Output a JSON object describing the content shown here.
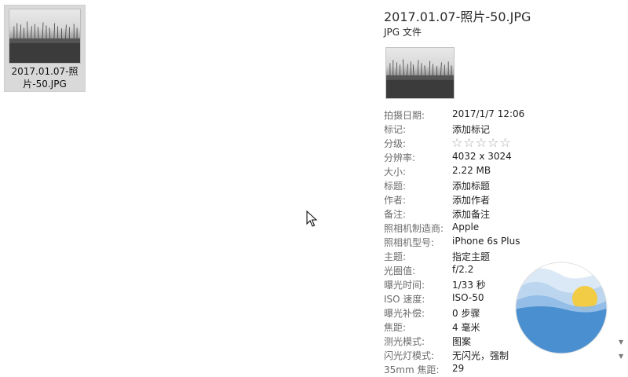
{
  "file_tile": {
    "name": "2017.01.07-照片-50.JPG"
  },
  "details": {
    "file_name": "2017.01.07-照片-50.JPG",
    "file_type": "JPG 文件",
    "properties": [
      {
        "label": "拍摄日期:",
        "value": "2017/1/7 12:06"
      },
      {
        "label": "标记:",
        "value": "添加标记"
      },
      {
        "label": "分级:",
        "value": "☆☆☆☆☆",
        "rating": 0,
        "rating_max": 5
      },
      {
        "label": "分辨率:",
        "value": "4032 x 3024"
      },
      {
        "label": "大小:",
        "value": "2.22 MB"
      },
      {
        "label": "标题:",
        "value": "添加标题"
      },
      {
        "label": "作者:",
        "value": "添加作者"
      },
      {
        "label": "备注:",
        "value": "添加备注"
      },
      {
        "label": "照相机制造商:",
        "value": "Apple"
      },
      {
        "label": "照相机型号:",
        "value": "iPhone 6s Plus"
      },
      {
        "label": "主题:",
        "value": "指定主题"
      },
      {
        "label": "光圈值:",
        "value": "f/2.2"
      },
      {
        "label": "曝光时间:",
        "value": "1/33 秒"
      },
      {
        "label": "ISO 速度:",
        "value": "ISO-50"
      },
      {
        "label": "曝光补偿:",
        "value": "0 步骤"
      },
      {
        "label": "焦距:",
        "value": "4 毫米"
      },
      {
        "label": "测光模式:",
        "value": "图案"
      },
      {
        "label": "闪光灯模式:",
        "value": "无闪光，强制"
      },
      {
        "label": "35mm 焦距:",
        "value": "29"
      }
    ]
  },
  "icons": {
    "cursor": "arrow-cursor-icon",
    "logo": "sea-sun-logo-icon",
    "scroll": "chevron-down-icon"
  },
  "colors": {
    "logo_blue": "#4a8fd0",
    "logo_sun": "#f2cc45",
    "label_gray": "#6b6b6b"
  }
}
